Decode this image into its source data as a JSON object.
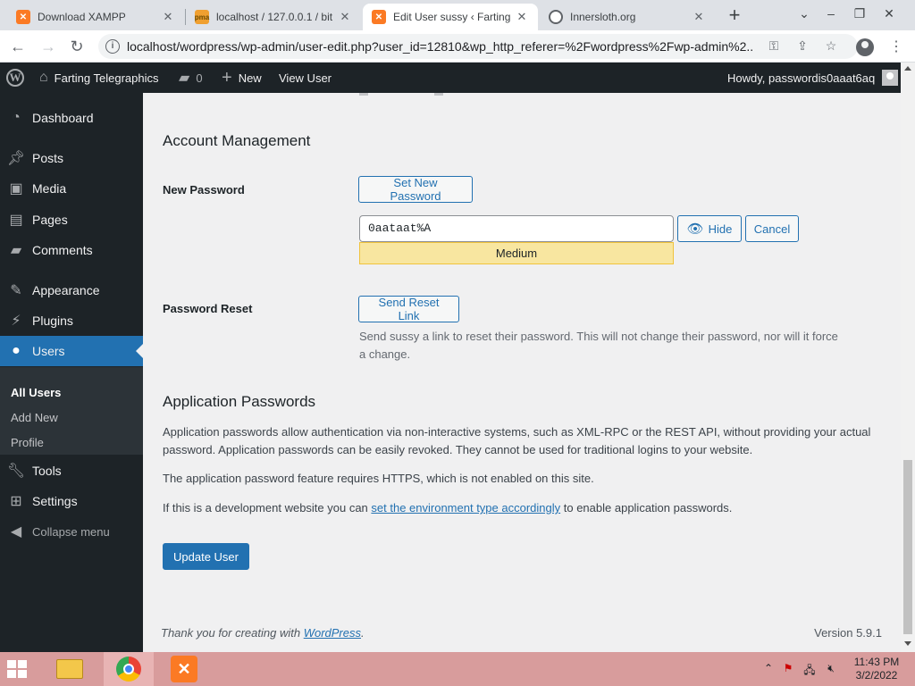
{
  "browser": {
    "tabs": [
      {
        "title": "Download XAMPP",
        "active": false
      },
      {
        "title": "localhost / 127.0.0.1 / bit",
        "active": false
      },
      {
        "title": "Edit User sussy ‹ Farting",
        "active": true
      },
      {
        "title": "Innersloth.org",
        "active": false
      }
    ],
    "url": "localhost/wordpress/wp-admin/user-edit.php?user_id=12810&wp_http_referer=%2Fwordpress%2Fwp-admin%2..."
  },
  "adminbar": {
    "site_name": "Farting Telegraphics",
    "comments_count": "0",
    "new_label": "New",
    "view_user_label": "View User",
    "howdy": "Howdy, passwordis0aaat6aq"
  },
  "sidebar": {
    "items": [
      {
        "label": "Dashboard",
        "icon": "dashboard-icon"
      },
      {
        "label": "Posts",
        "icon": "pin-icon"
      },
      {
        "label": "Media",
        "icon": "media-icon"
      },
      {
        "label": "Pages",
        "icon": "pages-icon"
      },
      {
        "label": "Comments",
        "icon": "comment-icon"
      },
      {
        "label": "Appearance",
        "icon": "brush-icon"
      },
      {
        "label": "Plugins",
        "icon": "plug-icon"
      },
      {
        "label": "Users",
        "icon": "user-icon"
      },
      {
        "label": "Tools",
        "icon": "wrench-icon"
      },
      {
        "label": "Settings",
        "icon": "settings-icon"
      },
      {
        "label": "Collapse menu",
        "icon": "collapse-icon"
      }
    ],
    "users_submenu": [
      "All Users",
      "Add New",
      "Profile"
    ]
  },
  "content": {
    "account_management": {
      "heading": "Account Management",
      "new_password_label": "New Password",
      "set_new_password_button": "Set New Password",
      "password_value": "0aataat%A",
      "strength": "Medium",
      "hide_button": "Hide",
      "cancel_button": "Cancel",
      "password_reset_label": "Password Reset",
      "send_reset_link_button": "Send Reset Link",
      "reset_desc_line1": "Send sussy a link to reset their password. This will not change their password, nor will it force",
      "reset_desc_line2": "a change."
    },
    "application_passwords": {
      "heading": "Application Passwords",
      "para1_line1": "Application passwords allow authentication via non-interactive systems, such as XML-RPC or the REST API, without providing your actual",
      "para1_line2": "password. Application passwords can be easily revoked. They cannot be used for traditional logins to your website.",
      "para2": "The application password feature requires HTTPS, which is not enabled on this site.",
      "para3_before": "If this is a development website you can ",
      "para3_link": "set the environment type accordingly",
      "para3_after": " to enable application passwords."
    },
    "update_user_button": "Update User",
    "footer_thanks_before": "Thank you for creating with ",
    "footer_thanks_link": "WordPress",
    "footer_thanks_after": ".",
    "footer_version": "Version 5.9.1"
  },
  "taskbar": {
    "time": "11:43 PM",
    "date": "3/2/2022"
  }
}
